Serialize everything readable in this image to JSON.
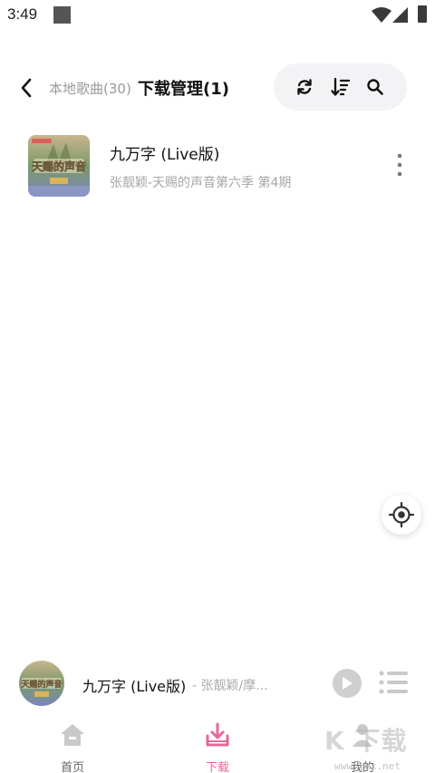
{
  "status_bar": {
    "time": "3:49"
  },
  "header": {
    "breadcrumb": "本地歌曲(30)",
    "title": "下载管理(1)",
    "tools": [
      "refresh-icon",
      "sort-icon",
      "search-icon"
    ]
  },
  "songs": [
    {
      "title": "九万字 (Live版)",
      "subtitle": "张靓颖-天赐的声音第六季 第4期"
    }
  ],
  "mini_player": {
    "title": "九万字 (Live版)",
    "artist": "- 张靓颖/摩..."
  },
  "nav": {
    "items": [
      {
        "label": "首页",
        "icon": "home-icon",
        "active": false
      },
      {
        "label": "下载",
        "icon": "download-icon",
        "active": true
      },
      {
        "label": "我的",
        "icon": "profile-icon",
        "active": false
      }
    ]
  },
  "watermark": {
    "text": "K 下载",
    "url": "www.kkx.net"
  },
  "colors": {
    "accent": "#e8669a",
    "tool_pill_bg": "#f3f3f5"
  }
}
